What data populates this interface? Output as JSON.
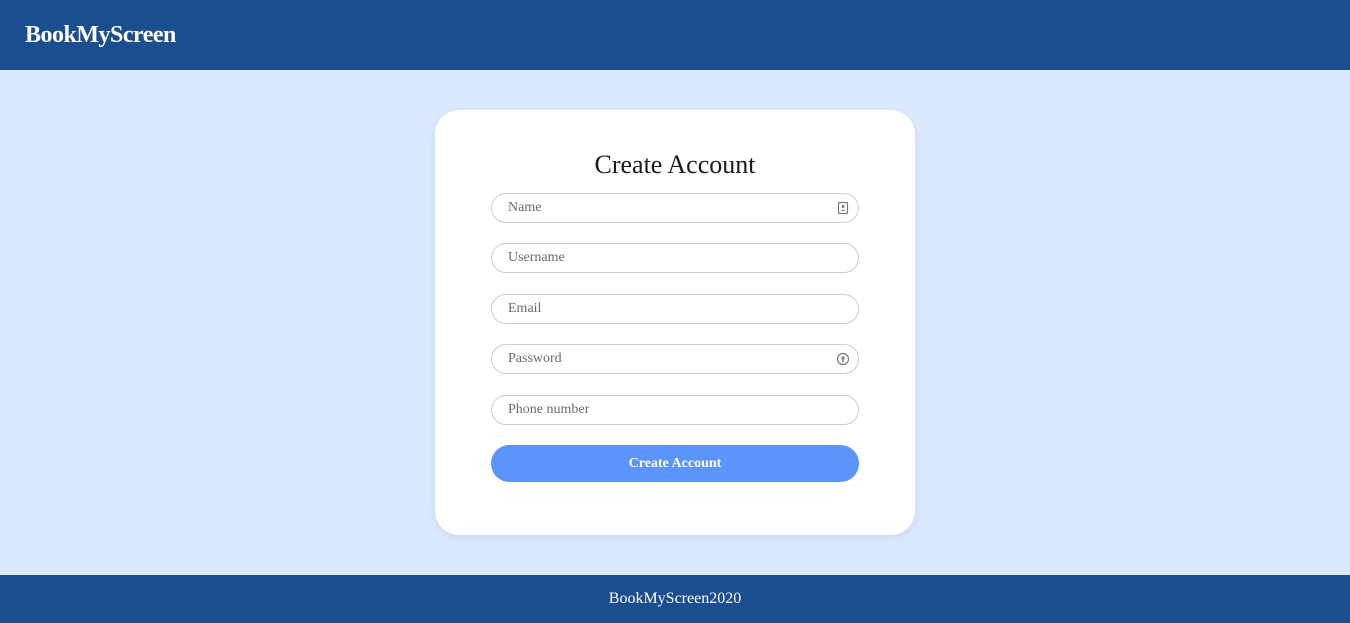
{
  "navbar": {
    "brand": "BookMyScreen"
  },
  "form": {
    "title": "Create Account",
    "fields": {
      "name": {
        "placeholder": "Name",
        "value": "",
        "icon": "contact-card-icon"
      },
      "username": {
        "placeholder": "Username",
        "value": ""
      },
      "email": {
        "placeholder": "Email",
        "value": ""
      },
      "password": {
        "placeholder": "Password",
        "value": "",
        "icon": "password-manager-icon"
      },
      "phone": {
        "placeholder": "Phone number",
        "value": ""
      }
    },
    "submit_label": "Create Account"
  },
  "footer": {
    "text": "BookMyScreen2020"
  },
  "colors": {
    "navbar_bg": "#1b4e8e",
    "page_bg": "#dce8fd",
    "card_bg": "#ffffff",
    "button_bg": "#5b94fb",
    "footer_bg": "#1b4e8e"
  }
}
